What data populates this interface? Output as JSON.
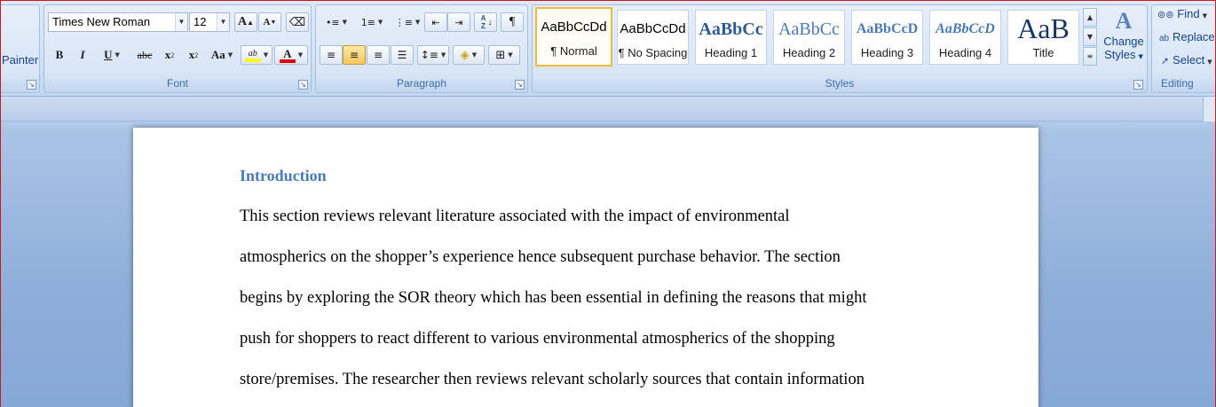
{
  "clipboard": {
    "format_painter_label": "Painter"
  },
  "font": {
    "group_label": "Font",
    "font_name": "Times New Roman",
    "font_size": "12",
    "grow_font": "A",
    "shrink_font": "A",
    "bold": "B",
    "italic": "I",
    "underline": "U",
    "strikethrough": "abc",
    "subscript": "x",
    "superscript": "x",
    "change_case": "Aa",
    "highlight": "ab",
    "font_color": "A",
    "highlight_color": "#ffff00",
    "font_color_value": "#e00000"
  },
  "paragraph": {
    "group_label": "Paragraph",
    "sort": "A Z",
    "show_marks": "¶"
  },
  "styles": {
    "group_label": "Styles",
    "tiles": [
      {
        "sample": "AaBbCcDd",
        "name": "¶ Normal"
      },
      {
        "sample": "AaBbCcDd",
        "name": "¶ No Spacing"
      },
      {
        "sample": "AaBbCc",
        "name": "Heading 1"
      },
      {
        "sample": "AaBbCc",
        "name": "Heading 2"
      },
      {
        "sample": "AaBbCcD",
        "name": "Heading 3"
      },
      {
        "sample": "AaBbCcD",
        "name": "Heading 4"
      },
      {
        "sample": "AaB",
        "name": "Title"
      }
    ],
    "change_styles_line1": "Change",
    "change_styles_line2": "Styles"
  },
  "editing": {
    "group_label": "Editing",
    "find": "Find",
    "replace": "Replace",
    "select": "Select"
  },
  "document": {
    "heading": "Introduction",
    "lines": [
      "This section reviews relevant literature associated with the impact of environmental",
      "atmospherics on the shopper’s experience hence subsequent purchase behavior. The section",
      "begins by exploring the SOR theory which has been essential in defining the reasons that might",
      "push for shoppers to react different to various environmental atmospherics of the shopping",
      "store/premises. The researcher then reviews relevant scholarly sources that contain information"
    ]
  }
}
